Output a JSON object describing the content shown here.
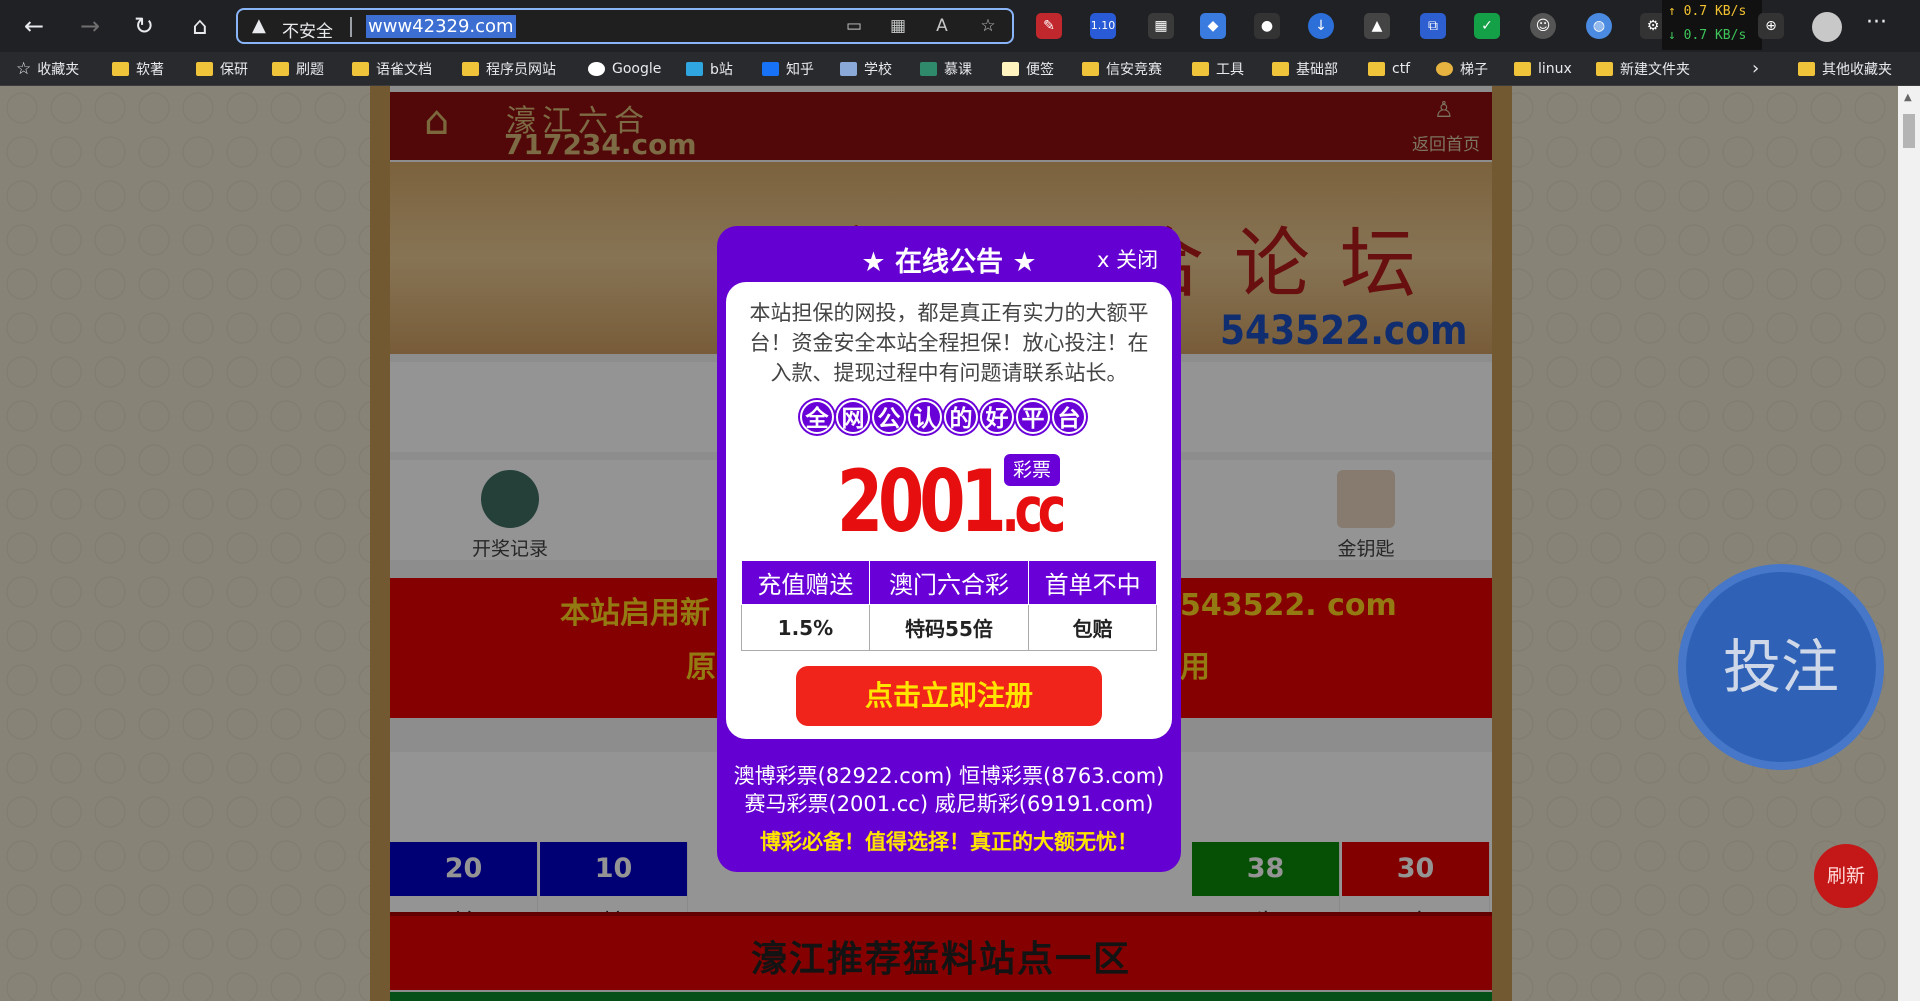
{
  "browser": {
    "insecure_label": "不安全",
    "url": "www42329.com",
    "update_badge": "1.10",
    "net_up": "↑ 0.7 KB/s",
    "net_down": "↓ 0.7 KB/s"
  },
  "bookmarks": [
    {
      "label": "收藏夹",
      "icon": "star-icon"
    },
    {
      "label": "软著",
      "icon": "folder-icon"
    },
    {
      "label": "保研",
      "icon": "folder-icon"
    },
    {
      "label": "刷题",
      "icon": "folder-icon"
    },
    {
      "label": "语雀文档",
      "icon": "folder-icon"
    },
    {
      "label": "程序员网站",
      "icon": "folder-icon"
    },
    {
      "label": "Google",
      "icon": "google-icon"
    },
    {
      "label": "b站",
      "icon": "bilibili-icon"
    },
    {
      "label": "知乎",
      "icon": "zhihu-icon"
    },
    {
      "label": "学校",
      "icon": "school-icon"
    },
    {
      "label": "慕课",
      "icon": "mooc-icon"
    },
    {
      "label": "便签",
      "icon": "note-icon"
    },
    {
      "label": "信安竞赛",
      "icon": "folder-icon"
    },
    {
      "label": "工具",
      "icon": "folder-icon"
    },
    {
      "label": "基础部",
      "icon": "folder-icon"
    },
    {
      "label": "ctf",
      "icon": "folder-icon"
    },
    {
      "label": "梯子",
      "icon": "ladder-icon"
    },
    {
      "label": "linux",
      "icon": "folder-icon"
    },
    {
      "label": "新建文件夹",
      "icon": "folder-icon"
    }
  ],
  "other_bookmarks": "其他收藏夹",
  "site": {
    "logo_cn": "濠江六合",
    "logo_domain": "717234.com",
    "home_link": "返回首页",
    "banner_title": "濠江六合论坛",
    "banner_domain": "543522.com",
    "nav": [
      {
        "label": "开奖记录"
      },
      {
        "label": "金钥匙"
      }
    ],
    "notice_left_1": "本站启用新",
    "notice_right_1": "543522. com",
    "notice_left_2": "原",
    "notice_right_2": "用",
    "results": [
      {
        "number": "20",
        "zodiac": "羊",
        "color": "#0000c8"
      },
      {
        "number": "10",
        "zodiac": "蛇",
        "color": "#0000c8"
      },
      {
        "number": "38",
        "zodiac": "牛",
        "color": "#0a8a0a"
      },
      {
        "number": "30",
        "zodiac": "鸡",
        "color": "#e00000"
      }
    ],
    "recommend_title": "濠江推荐猛料站点一区"
  },
  "float": {
    "bet": "投注",
    "refresh": "刷新"
  },
  "modal": {
    "title": "★ 在线公告 ★",
    "close": "x 关闭",
    "text": "本站担保的网投，都是真正有实力的大额平台！资金安全本站全程担保！放心投注！在入款、提现过程中有问题请联系站长。",
    "pills": [
      "全",
      "网",
      "公",
      "认",
      "的",
      "好",
      "平",
      "台"
    ],
    "big_domain_main": "2001",
    "big_domain_ext": ".cc",
    "tag": "彩票",
    "table_headers": [
      "充值赠送",
      "澳门六合彩",
      "首单不中"
    ],
    "table_values": [
      "1.5%",
      "特码55倍",
      "包赔"
    ],
    "register": "点击立即注册",
    "partners_1": "澳博彩票(82922.com) 恒博彩票(8763.com)",
    "partners_2": "赛马彩票(2001.cc) 威尼斯彩(69191.com)",
    "slogan": "博彩必备！值得选择！真正的大额无忧！"
  }
}
